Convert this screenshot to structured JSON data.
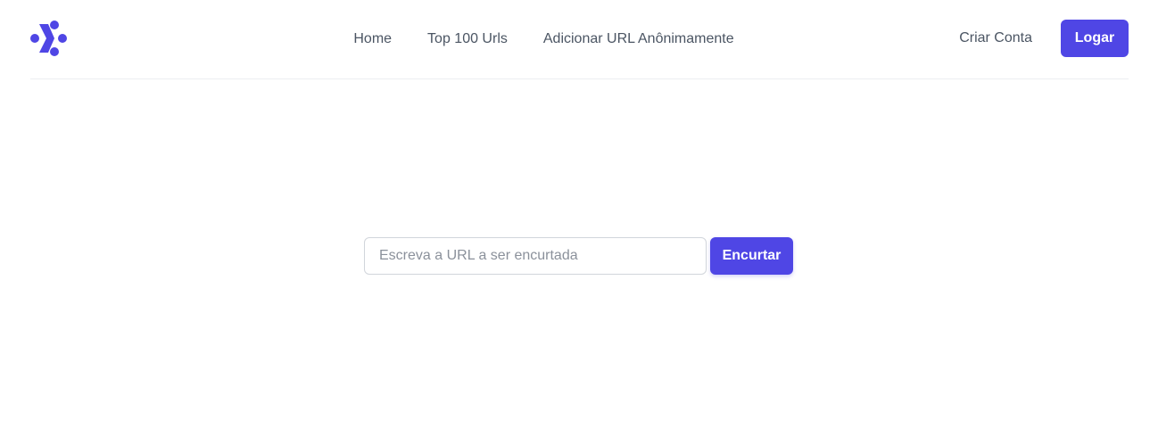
{
  "brand": {
    "accent": "#4f46e5",
    "logo_icon": "dots-chevron-logo-icon"
  },
  "nav": {
    "items": [
      {
        "label": "Home"
      },
      {
        "label": "Top 100 Urls"
      },
      {
        "label": "Adicionar URL Anônimamente"
      }
    ]
  },
  "auth": {
    "signup_label": "Criar Conta",
    "login_label": "Logar"
  },
  "shortener": {
    "placeholder": "Escreva a URL a ser encurtada",
    "value": "",
    "submit_label": "Encurtar"
  }
}
